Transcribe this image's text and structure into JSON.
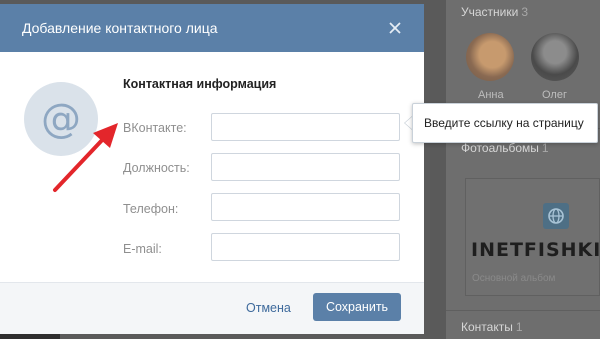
{
  "background": {
    "participants_heading": "Участники",
    "participants_count": "3",
    "members": [
      {
        "name": "Анна"
      },
      {
        "name": "Олег"
      }
    ],
    "albums_heading": "Фотоальбомы",
    "albums_count": "1",
    "album_logo_text": "INETFISHKI",
    "album_caption": "Основной альбом",
    "contacts_heading": "Контакты",
    "contacts_count": "1"
  },
  "dialog": {
    "title": "Добавление контактного лица",
    "close_icon": "close-icon",
    "avatar_symbol": "@",
    "section_title": "Контактная информация",
    "fields": [
      {
        "label": "ВКонтакте:",
        "value": "",
        "placeholder": ""
      },
      {
        "label": "Должность:",
        "value": "",
        "placeholder": ""
      },
      {
        "label": "Телефон:",
        "value": "",
        "placeholder": ""
      },
      {
        "label": "E-mail:",
        "value": "",
        "placeholder": ""
      }
    ],
    "cancel_label": "Отмена",
    "save_label": "Сохранить"
  },
  "tooltip": {
    "text": "Введите ссылку на страницу"
  },
  "colors": {
    "header_blue": "#5b80a8",
    "link_blue": "#3e6a9c",
    "annotation_red": "#e3262b"
  }
}
